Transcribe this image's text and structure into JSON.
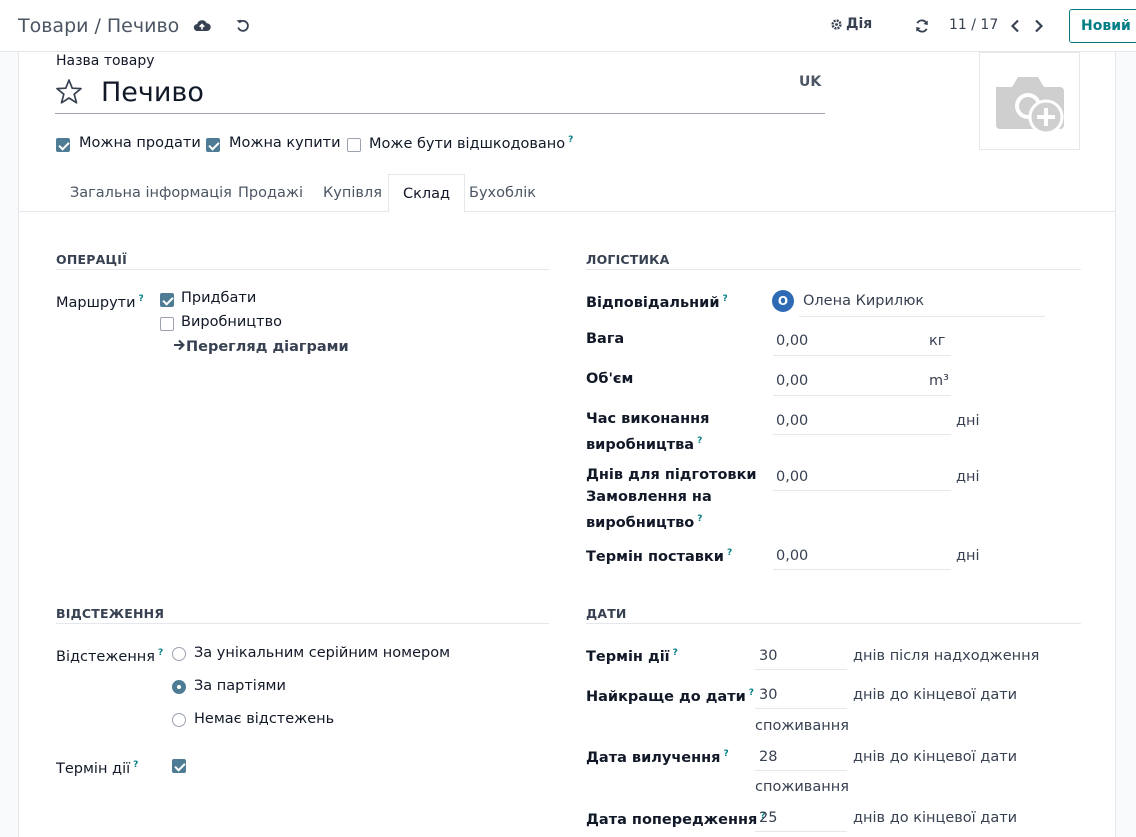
{
  "breadcrumb": {
    "parent": "Товари",
    "separator": "/",
    "current": "Печиво"
  },
  "toolbar": {
    "action_label": "Дія",
    "pager": "11 / 17",
    "new_label": "Новий"
  },
  "product": {
    "name_label": "Назва товару",
    "name": "Печиво",
    "lang": "UK",
    "flags": [
      {
        "label": "Можна продати",
        "checked": true
      },
      {
        "label": "Можна купити",
        "checked": true
      },
      {
        "label": "Може бути відшкодовано",
        "checked": false
      }
    ]
  },
  "tabs": [
    {
      "label": "Загальна інформація",
      "active": false
    },
    {
      "label": "Продажі",
      "active": false
    },
    {
      "label": "Купівля",
      "active": false
    },
    {
      "label": "Склад",
      "active": true
    },
    {
      "label": "Бухоблік",
      "active": false
    }
  ],
  "operations": {
    "title": "ОПЕРАЦІЇ",
    "routes_label": "Маршрути",
    "routes": [
      {
        "label": "Придбати",
        "checked": true
      },
      {
        "label": "Виробництво",
        "checked": false
      }
    ],
    "diagram_link": "Перегляд діаграми"
  },
  "logistics": {
    "title": "ЛОГІСТИКА",
    "responsible_label": "Відповідальний",
    "responsible_initial": "O",
    "responsible_name": "Олена Кирилюк",
    "weight_label": "Вага",
    "weight_value": "0,00",
    "weight_unit": "кг",
    "volume_label": "Об'єм",
    "volume_value": "0,00",
    "volume_unit": "m³",
    "mfg_lead_label_1": "Час виконання",
    "mfg_lead_label_2": "виробництва",
    "mfg_lead_value": "0,00",
    "mfg_lead_unit": "дні",
    "prep_label_1": "Днів для підготовки",
    "prep_label_2": "Замовлення на",
    "prep_label_3": "виробництво",
    "prep_value": "0,00",
    "prep_unit": "дні",
    "delivery_label": "Термін поставки",
    "delivery_value": "0,00",
    "delivery_unit": "дні"
  },
  "tracking": {
    "title": "ВІДСТЕЖЕННЯ",
    "label": "Відстеження",
    "options": [
      {
        "label": "За унікальним серійним номером",
        "selected": false
      },
      {
        "label": "За партіями",
        "selected": true
      },
      {
        "label": "Немає відстежень",
        "selected": false
      }
    ],
    "expiry_label": "Термін дії",
    "expiry_checked": true
  },
  "dates": {
    "title": "ДАТИ",
    "expiration_label": "Термін дії",
    "expiration_value": "30",
    "expiration_unit": "днів після надходження",
    "best_before_label": "Найкраще до дати",
    "best_before_value": "30",
    "best_before_unit_1": "днів до кінцевої дати",
    "best_before_unit_2": "споживання",
    "removal_label": "Дата вилучення",
    "removal_value": "28",
    "removal_unit_1": "днів до кінцевої дати",
    "removal_unit_2": "споживання",
    "alert_label": "Дата попередження",
    "alert_value": "25",
    "alert_unit_1": "днів до кінцевої дати"
  },
  "help_mark": "?"
}
